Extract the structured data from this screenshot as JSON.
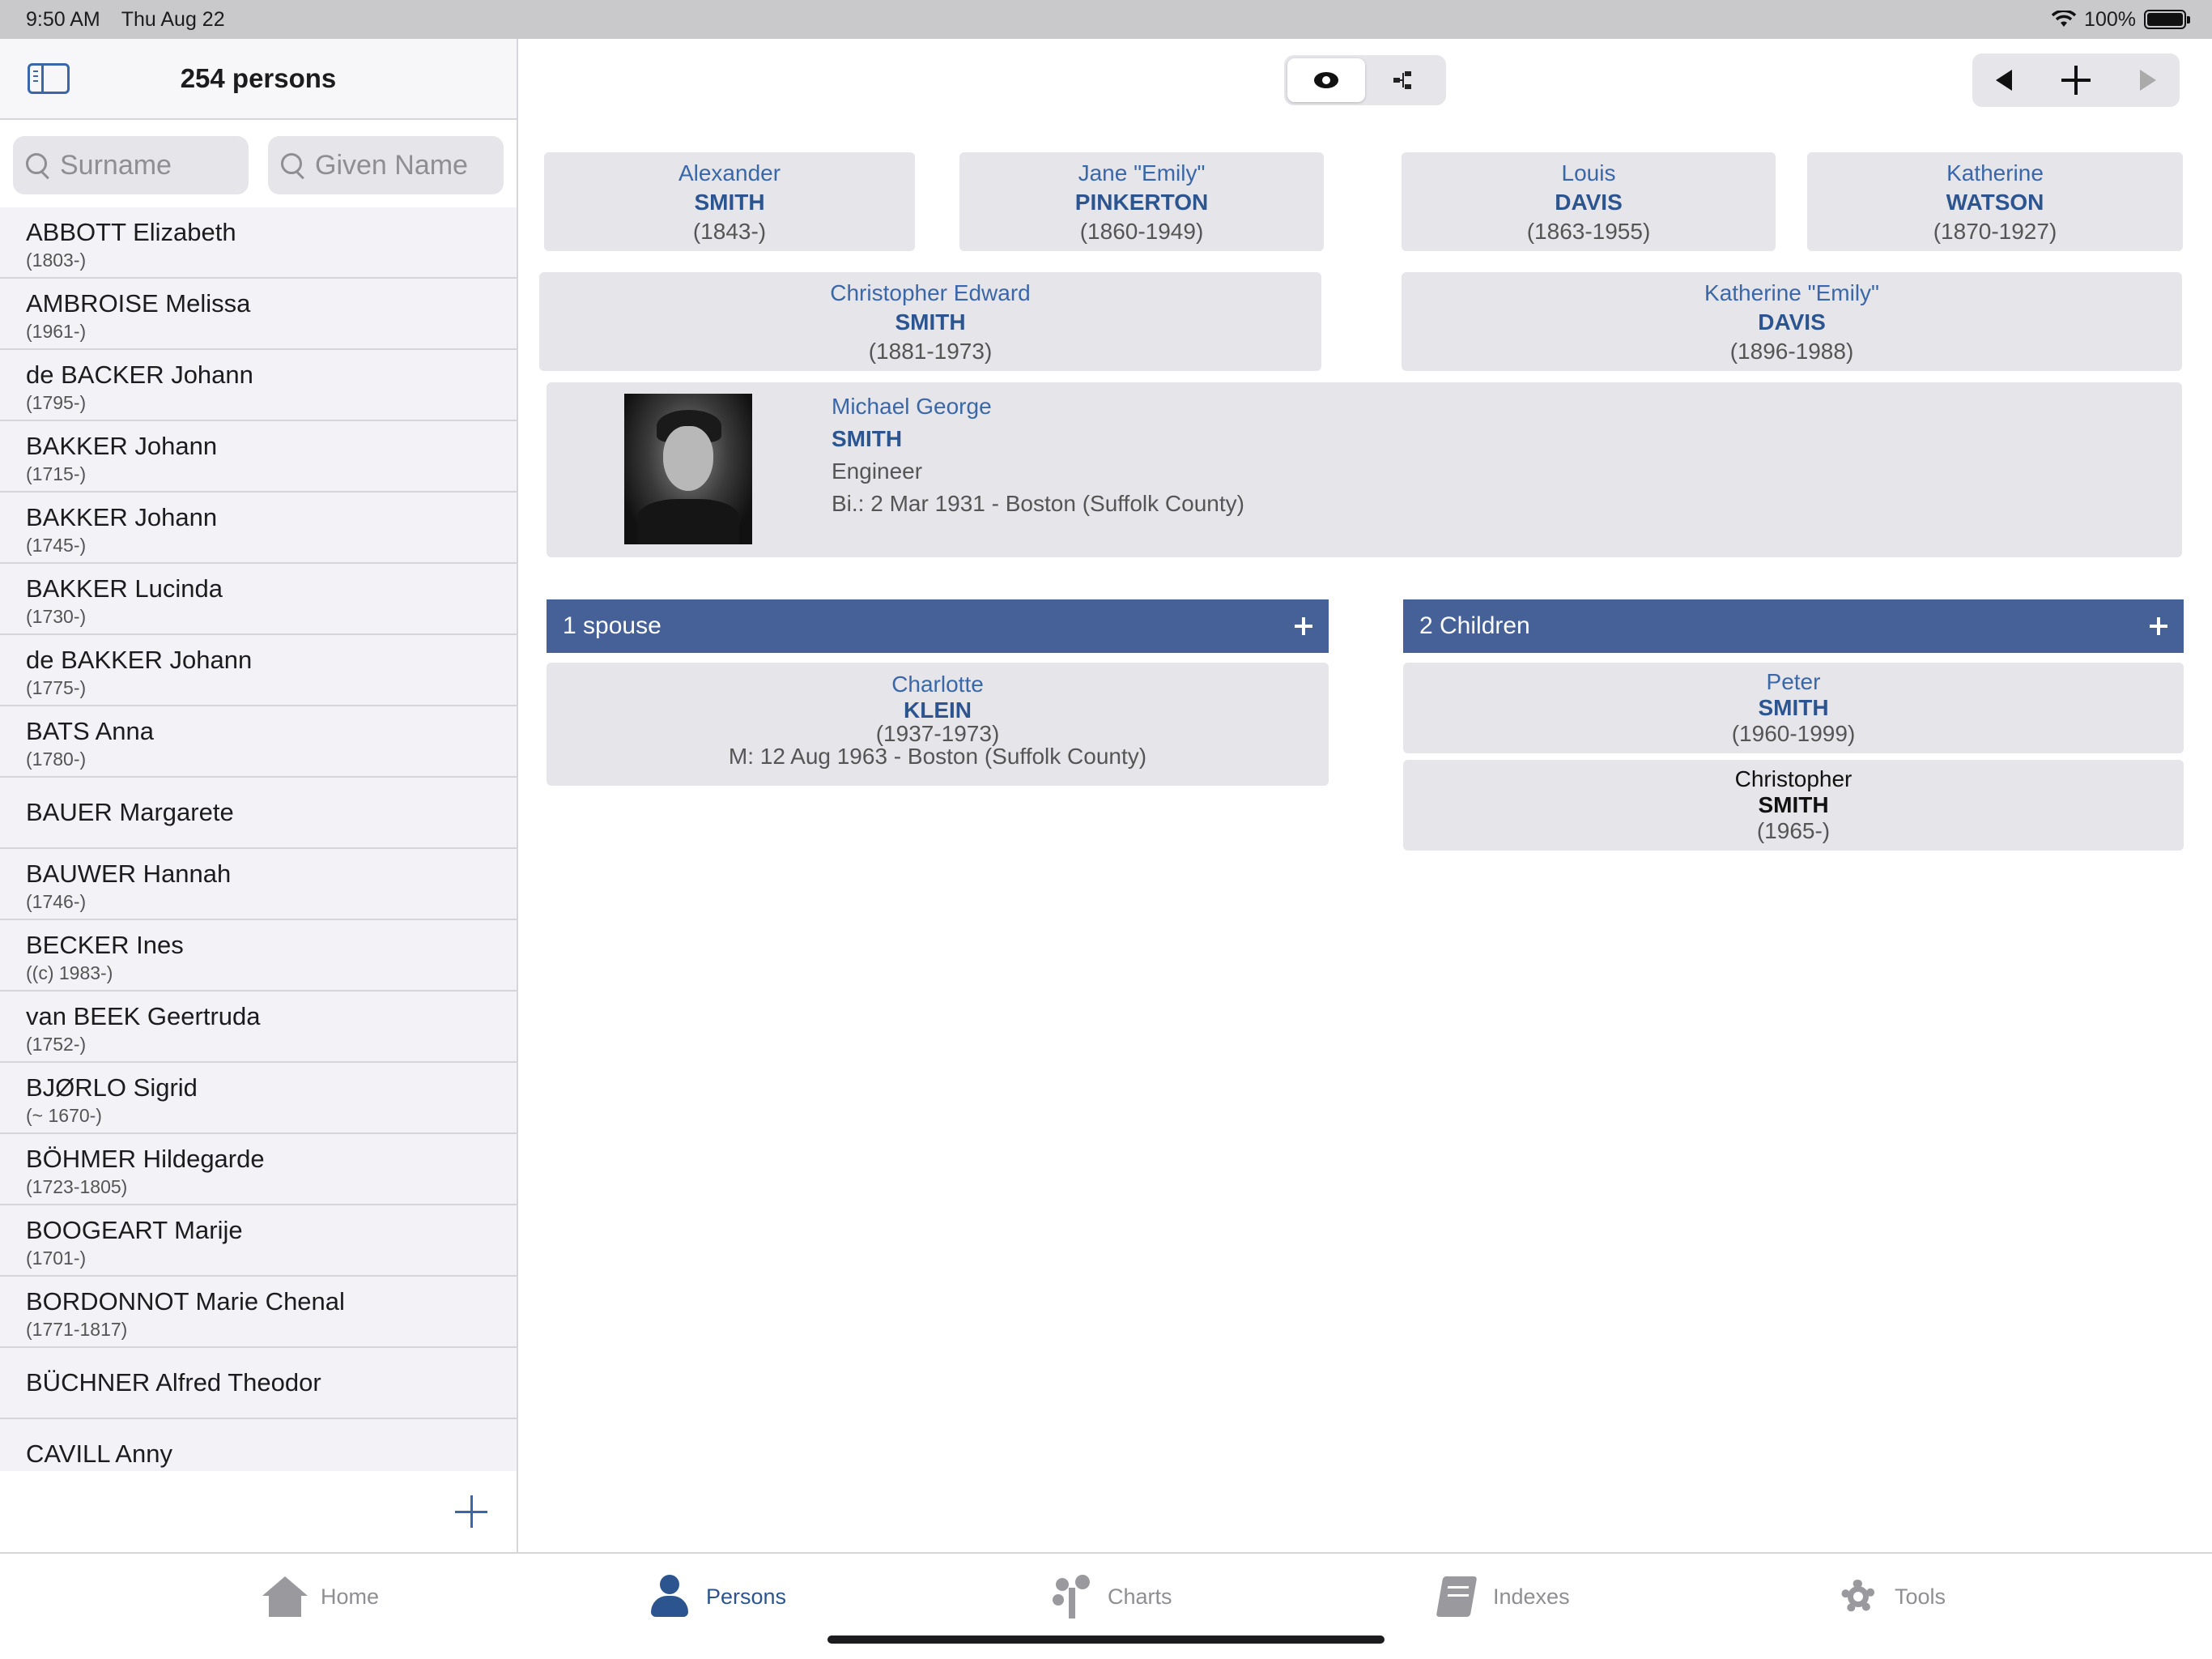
{
  "status": {
    "time": "9:50 AM",
    "date": "Thu Aug 22",
    "battery": "100%"
  },
  "sidebar": {
    "title": "254 persons",
    "surname_placeholder": "Surname",
    "given_placeholder": "Given Name",
    "persons": [
      {
        "name": "ABBOTT Elizabeth",
        "dates": "(1803-)"
      },
      {
        "name": "AMBROISE Melissa",
        "dates": "(1961-)"
      },
      {
        "name": "de BACKER Johann",
        "dates": "(1795-)"
      },
      {
        "name": "BAKKER Johann",
        "dates": "(1715-)"
      },
      {
        "name": "BAKKER Johann",
        "dates": "(1745-)"
      },
      {
        "name": "BAKKER Lucinda",
        "dates": "(1730-)"
      },
      {
        "name": "de BAKKER Johann",
        "dates": "(1775-)"
      },
      {
        "name": "BATS Anna",
        "dates": "(1780-)"
      },
      {
        "name": "BAUER Margarete",
        "dates": ""
      },
      {
        "name": "BAUWER Hannah",
        "dates": "(1746-)"
      },
      {
        "name": "BECKER Ines",
        "dates": "((c) 1983-)"
      },
      {
        "name": "van BEEK Geertruda",
        "dates": "(1752-)"
      },
      {
        "name": "BJØRLO Sigrid",
        "dates": "(~ 1670-)"
      },
      {
        "name": "BÖHMER Hildegarde",
        "dates": "(1723-1805)"
      },
      {
        "name": "BOOGEART Marije",
        "dates": "(1701-)"
      },
      {
        "name": "BORDONNOT Marie Chenal",
        "dates": "(1771-1817)"
      },
      {
        "name": "BÜCHNER Alfred Theodor",
        "dates": ""
      },
      {
        "name": "CAVILL Anny",
        "dates": ""
      }
    ]
  },
  "grandparents": [
    {
      "given": "Alexander",
      "surname": "SMITH",
      "dates": "(1843-)"
    },
    {
      "given": "Jane \"Emily\"",
      "surname": "PINKERTON",
      "dates": "(1860-1949)"
    },
    {
      "given": "Louis",
      "surname": "DAVIS",
      "dates": "(1863-1955)"
    },
    {
      "given": "Katherine",
      "surname": "WATSON",
      "dates": "(1870-1927)"
    }
  ],
  "parents": [
    {
      "given": "Christopher Edward",
      "surname": "SMITH",
      "dates": "(1881-1973)"
    },
    {
      "given": "Katherine \"Emily\"",
      "surname": "DAVIS",
      "dates": "(1896-1988)"
    }
  ],
  "focus": {
    "given": "Michael George",
    "surname": "SMITH",
    "occupation": "Engineer",
    "birth": "Bi.: 2 Mar 1931 - Boston (Suffolk County)"
  },
  "spouses": {
    "header": "1 spouse",
    "items": [
      {
        "given": "Charlotte",
        "surname": "KLEIN",
        "dates": "(1937-1973)",
        "marriage": "M: 12 Aug 1963 - Boston (Suffolk County)"
      }
    ]
  },
  "children": {
    "header": "2 Children",
    "items": [
      {
        "given": "Peter",
        "surname": "SMITH",
        "dates": "(1960-1999)"
      },
      {
        "given": "Christopher",
        "surname": "SMITH",
        "dates": "(1965-)"
      }
    ]
  },
  "tabs": [
    {
      "label": "Home",
      "icon": "home-icon"
    },
    {
      "label": "Persons",
      "icon": "person-icon"
    },
    {
      "label": "Charts",
      "icon": "tree-chart-icon"
    },
    {
      "label": "Indexes",
      "icon": "book-icon"
    },
    {
      "label": "Tools",
      "icon": "gear-icon"
    }
  ],
  "colors": {
    "accent": "#2c5590",
    "section_bar": "#456197",
    "card_bg": "#e5e5ea"
  }
}
